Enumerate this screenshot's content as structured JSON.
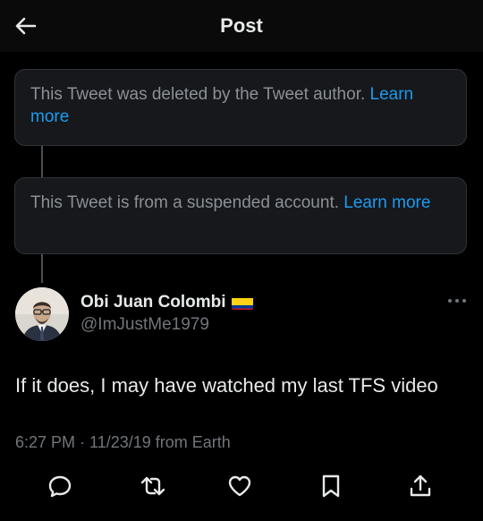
{
  "header": {
    "title": "Post"
  },
  "thread": {
    "notices": [
      {
        "text": "This Tweet was deleted by the Tweet author. ",
        "link": "Learn more"
      },
      {
        "text": "This Tweet is from a suspended account. ",
        "link": "Learn more"
      }
    ]
  },
  "tweet": {
    "author_name": "Obi Juan Colombi",
    "author_handle": "@ImJustMe1979",
    "text": "If it does, I may have watched my last TFS video",
    "meta": "6:27 PM · 11/23/19 from Earth"
  },
  "icons": {
    "back": "arrow-left-icon",
    "more": "more-dots-icon",
    "flag": "colombia-flag-icon",
    "reply": "reply-icon",
    "retweet": "retweet-icon",
    "like": "heart-icon",
    "bookmark": "bookmark-icon",
    "share": "share-icon"
  },
  "colors": {
    "background": "#000000",
    "card": "#16181c",
    "link": "#1d9bf0",
    "muted": "#71767b",
    "text": "#e7e9ea"
  }
}
